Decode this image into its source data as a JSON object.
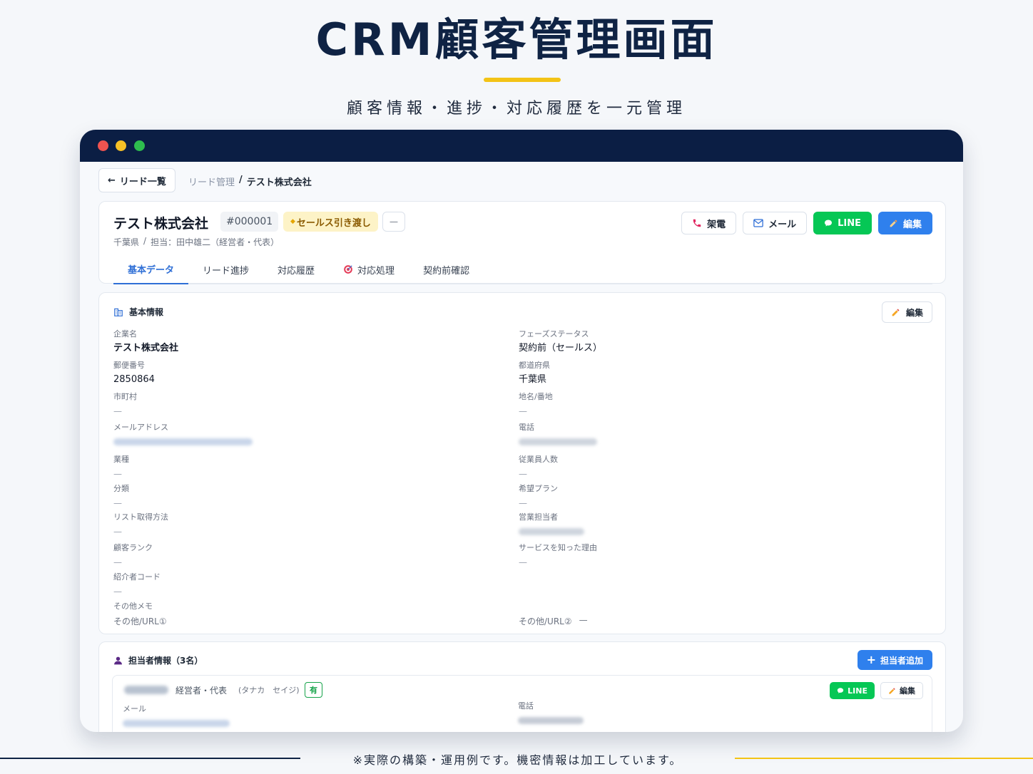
{
  "hero": {
    "title": "CRM顧客管理画面",
    "subtitle": "顧客情報・進捗・対応履歴を一元管理"
  },
  "nav": {
    "back_label": "リード一覧",
    "breadcrumb_parent": "リード管理",
    "breadcrumb_sep": "/",
    "breadcrumb_current": "テスト株式会社"
  },
  "header": {
    "company_name": "テスト株式会社",
    "lead_id": "#000001",
    "phase_badge": "セールス引き渡し",
    "dash_label": "—",
    "prefecture": "千葉県",
    "separator": "/",
    "owner": "担当：田中雄二（経営者・代表）",
    "buttons": {
      "call": "架電",
      "mail": "メール",
      "line": "LINE",
      "edit": "編集"
    },
    "tabs": [
      {
        "label": "基本データ"
      },
      {
        "label": "リード進捗"
      },
      {
        "label": "対応履歴"
      },
      {
        "label": "対応処理"
      },
      {
        "label": "契約前確認"
      }
    ]
  },
  "basic_info": {
    "title": "基本情報",
    "edit_label": "編集",
    "fields": {
      "company": {
        "label": "企業名",
        "value": "テスト株式会社"
      },
      "phase_status": {
        "label": "フェーズステータス",
        "value": "契約前（セールス）"
      },
      "postal": {
        "label": "郵便番号",
        "value": "2850864"
      },
      "prefecture": {
        "label": "都道府県",
        "value": "千葉県"
      },
      "city": {
        "label": "市町村",
        "value": "—"
      },
      "address": {
        "label": "地名/番地",
        "value": "—"
      },
      "email": {
        "label": "メールアドレス"
      },
      "phone": {
        "label": "電話"
      },
      "industry": {
        "label": "業種",
        "value": "—"
      },
      "employees": {
        "label": "従業員人数",
        "value": "—"
      },
      "category": {
        "label": "分類",
        "value": "—"
      },
      "plan": {
        "label": "希望プラン",
        "value": "—"
      },
      "list_method": {
        "label": "リスト取得方法",
        "value": "—"
      },
      "sales_rep": {
        "label": "営業担当者"
      },
      "customer_rank": {
        "label": "顧客ランク",
        "value": "—"
      },
      "reason": {
        "label": "サービスを知った理由",
        "value": "—"
      },
      "referral_code": {
        "label": "紹介者コード",
        "value": "—"
      },
      "other_memo": {
        "label": "その他メモ"
      },
      "other_url1": {
        "label": "その他/URL①"
      },
      "other_url2": {
        "label": "その他/URL②",
        "value": "—"
      }
    }
  },
  "contacts": {
    "title": "担当者情報（3名）",
    "add_label": "担当者追加",
    "item": {
      "role": "経営者・代表",
      "kana": "(タナカ　セイジ)",
      "badge": "有",
      "line_label": "LINE",
      "edit_label": "編集",
      "mail_label": "メール",
      "phone_label": "電話"
    }
  },
  "footer": {
    "note": "※実際の構築・運用例です。機密情報は加工しています。"
  },
  "colors": {
    "navy": "#0b1e44",
    "accent_yellow": "#f3c316",
    "primary_blue": "#2f80ed",
    "line_green": "#06c755",
    "badge_yellow_bg": "#fdf3c7"
  }
}
